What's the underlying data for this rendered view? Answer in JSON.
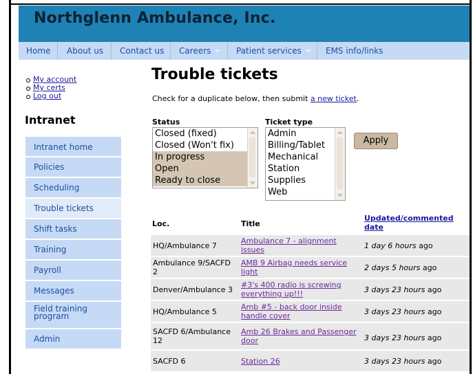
{
  "site": {
    "title": "Northglenn Ambulance, Inc."
  },
  "nav": {
    "items": [
      {
        "label": "Home"
      },
      {
        "label": "About us"
      },
      {
        "label": "Contact us"
      },
      {
        "label": "Careers"
      },
      {
        "label": "Patient services"
      },
      {
        "label": "EMS info/links"
      }
    ]
  },
  "account": {
    "links": [
      "My account",
      "My certs",
      "Log out"
    ]
  },
  "intranet": {
    "title": "Intranet",
    "items": [
      {
        "label": "Intranet home"
      },
      {
        "label": "Policies"
      },
      {
        "label": "Scheduling"
      },
      {
        "label": "Trouble tickets"
      },
      {
        "label": "Shift tasks"
      },
      {
        "label": "Training"
      },
      {
        "label": "Payroll"
      },
      {
        "label": "Messages"
      },
      {
        "label": "Field training program"
      },
      {
        "label": "Admin"
      }
    ],
    "active": "Trouble tickets"
  },
  "main": {
    "title": "Trouble tickets",
    "intro_prefix": "Check for a duplicate below, then submit ",
    "intro_link": "a new ticket",
    "intro_suffix": "."
  },
  "filters": {
    "status_label": "Status",
    "status_options": [
      "Closed (fixed)",
      "Closed (Won't fix)",
      "In progress",
      "Open",
      "Ready to close"
    ],
    "status_selected": [
      "In progress",
      "Open",
      "Ready to close"
    ],
    "type_label": "Ticket type",
    "type_options": [
      "Admin",
      "Billing/Tablet",
      "Mechanical",
      "Station",
      "Supplies",
      "Web"
    ],
    "apply_label": "Apply"
  },
  "table": {
    "headers": {
      "loc": "Loc.",
      "title": "Title",
      "date_line1": "Updated/commented",
      "date_line2": "date"
    },
    "rows": [
      {
        "loc": [
          "HQ/Ambulance 7"
        ],
        "title": [
          "Ambulance 7 - alignment",
          "issues"
        ],
        "date": "1 day 6 hours",
        "ago": " ago"
      },
      {
        "loc": [
          "Ambulance 9/SACFD",
          "2"
        ],
        "title": [
          "AMB 9 Airbag needs service",
          "light"
        ],
        "date": "2 days 5 hours",
        "ago": " ago"
      },
      {
        "loc": [
          "Denver/Ambulance 3"
        ],
        "title": [
          "#3's 400 radio is screwing",
          "everything up!!!"
        ],
        "date": "3 days 23 hours",
        "ago": " ago"
      },
      {
        "loc": [
          "HQ/Ambulance 5"
        ],
        "title": [
          "Amb #5 - back door inside",
          "handle cover"
        ],
        "date": "3 days 23 hours",
        "ago": " ago"
      },
      {
        "loc": [
          "SACFD 6/Ambulance",
          "12"
        ],
        "title": [
          "Amb 26 Brakes and Passenger",
          "door"
        ],
        "date": "3 days 23 hours",
        "ago": " ago"
      },
      {
        "loc": [
          "SACFD 6"
        ],
        "title": [
          "Station 26"
        ],
        "date": "3 days 23 hours",
        "ago": " ago"
      }
    ]
  },
  "colors": {
    "header_bg": "#1e82b4",
    "nav_bg": "#c6daf6",
    "link": "#1a1a9e",
    "visited_link": "#6a2a9a",
    "selected_option": "#d4c6b2",
    "button_bg": "#cab8a0",
    "row_bg": "#e8e8e8"
  }
}
